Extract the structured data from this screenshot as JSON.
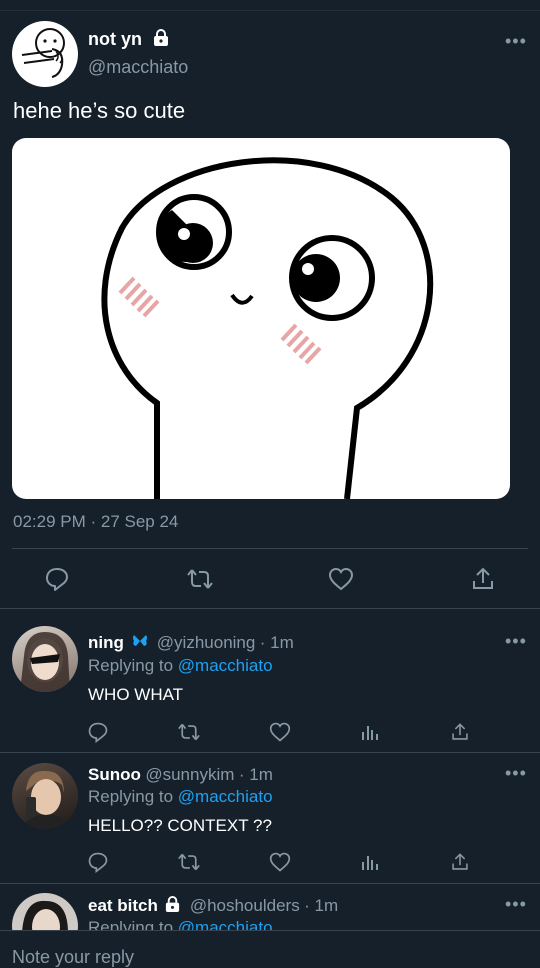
{
  "tweet": {
    "display_name": "not yn",
    "handle": "@macchiato",
    "text": "hehe he’s so cute",
    "timestamp": "02:29 PM · 27 Sep 24",
    "media_icon": "smiling-character-sticker"
  },
  "replies": [
    {
      "display_name": "ning",
      "badge_icon": "butterfly-icon",
      "handle": "@yizhuoning",
      "time": "· 1m",
      "replying_prefix": "Replying to",
      "replying_to": "@macchiato",
      "text": "WHO WHAT"
    },
    {
      "display_name": "Sunoo",
      "handle": "@sunnykim",
      "time": "· 1m",
      "replying_prefix": "Replying to",
      "replying_to": "@macchiato",
      "text": "HELLO?? CONTEXT ??"
    },
    {
      "display_name": "eat bitch",
      "handle": "@hoshoulders",
      "time": "· 1m",
      "replying_prefix": "Replying to",
      "replying_to": "@macchiato"
    }
  ],
  "composer": {
    "placeholder": "Note your reply"
  },
  "colors": {
    "background": "#15202b",
    "accent": "#1da1f2",
    "muted": "#8899a6"
  }
}
